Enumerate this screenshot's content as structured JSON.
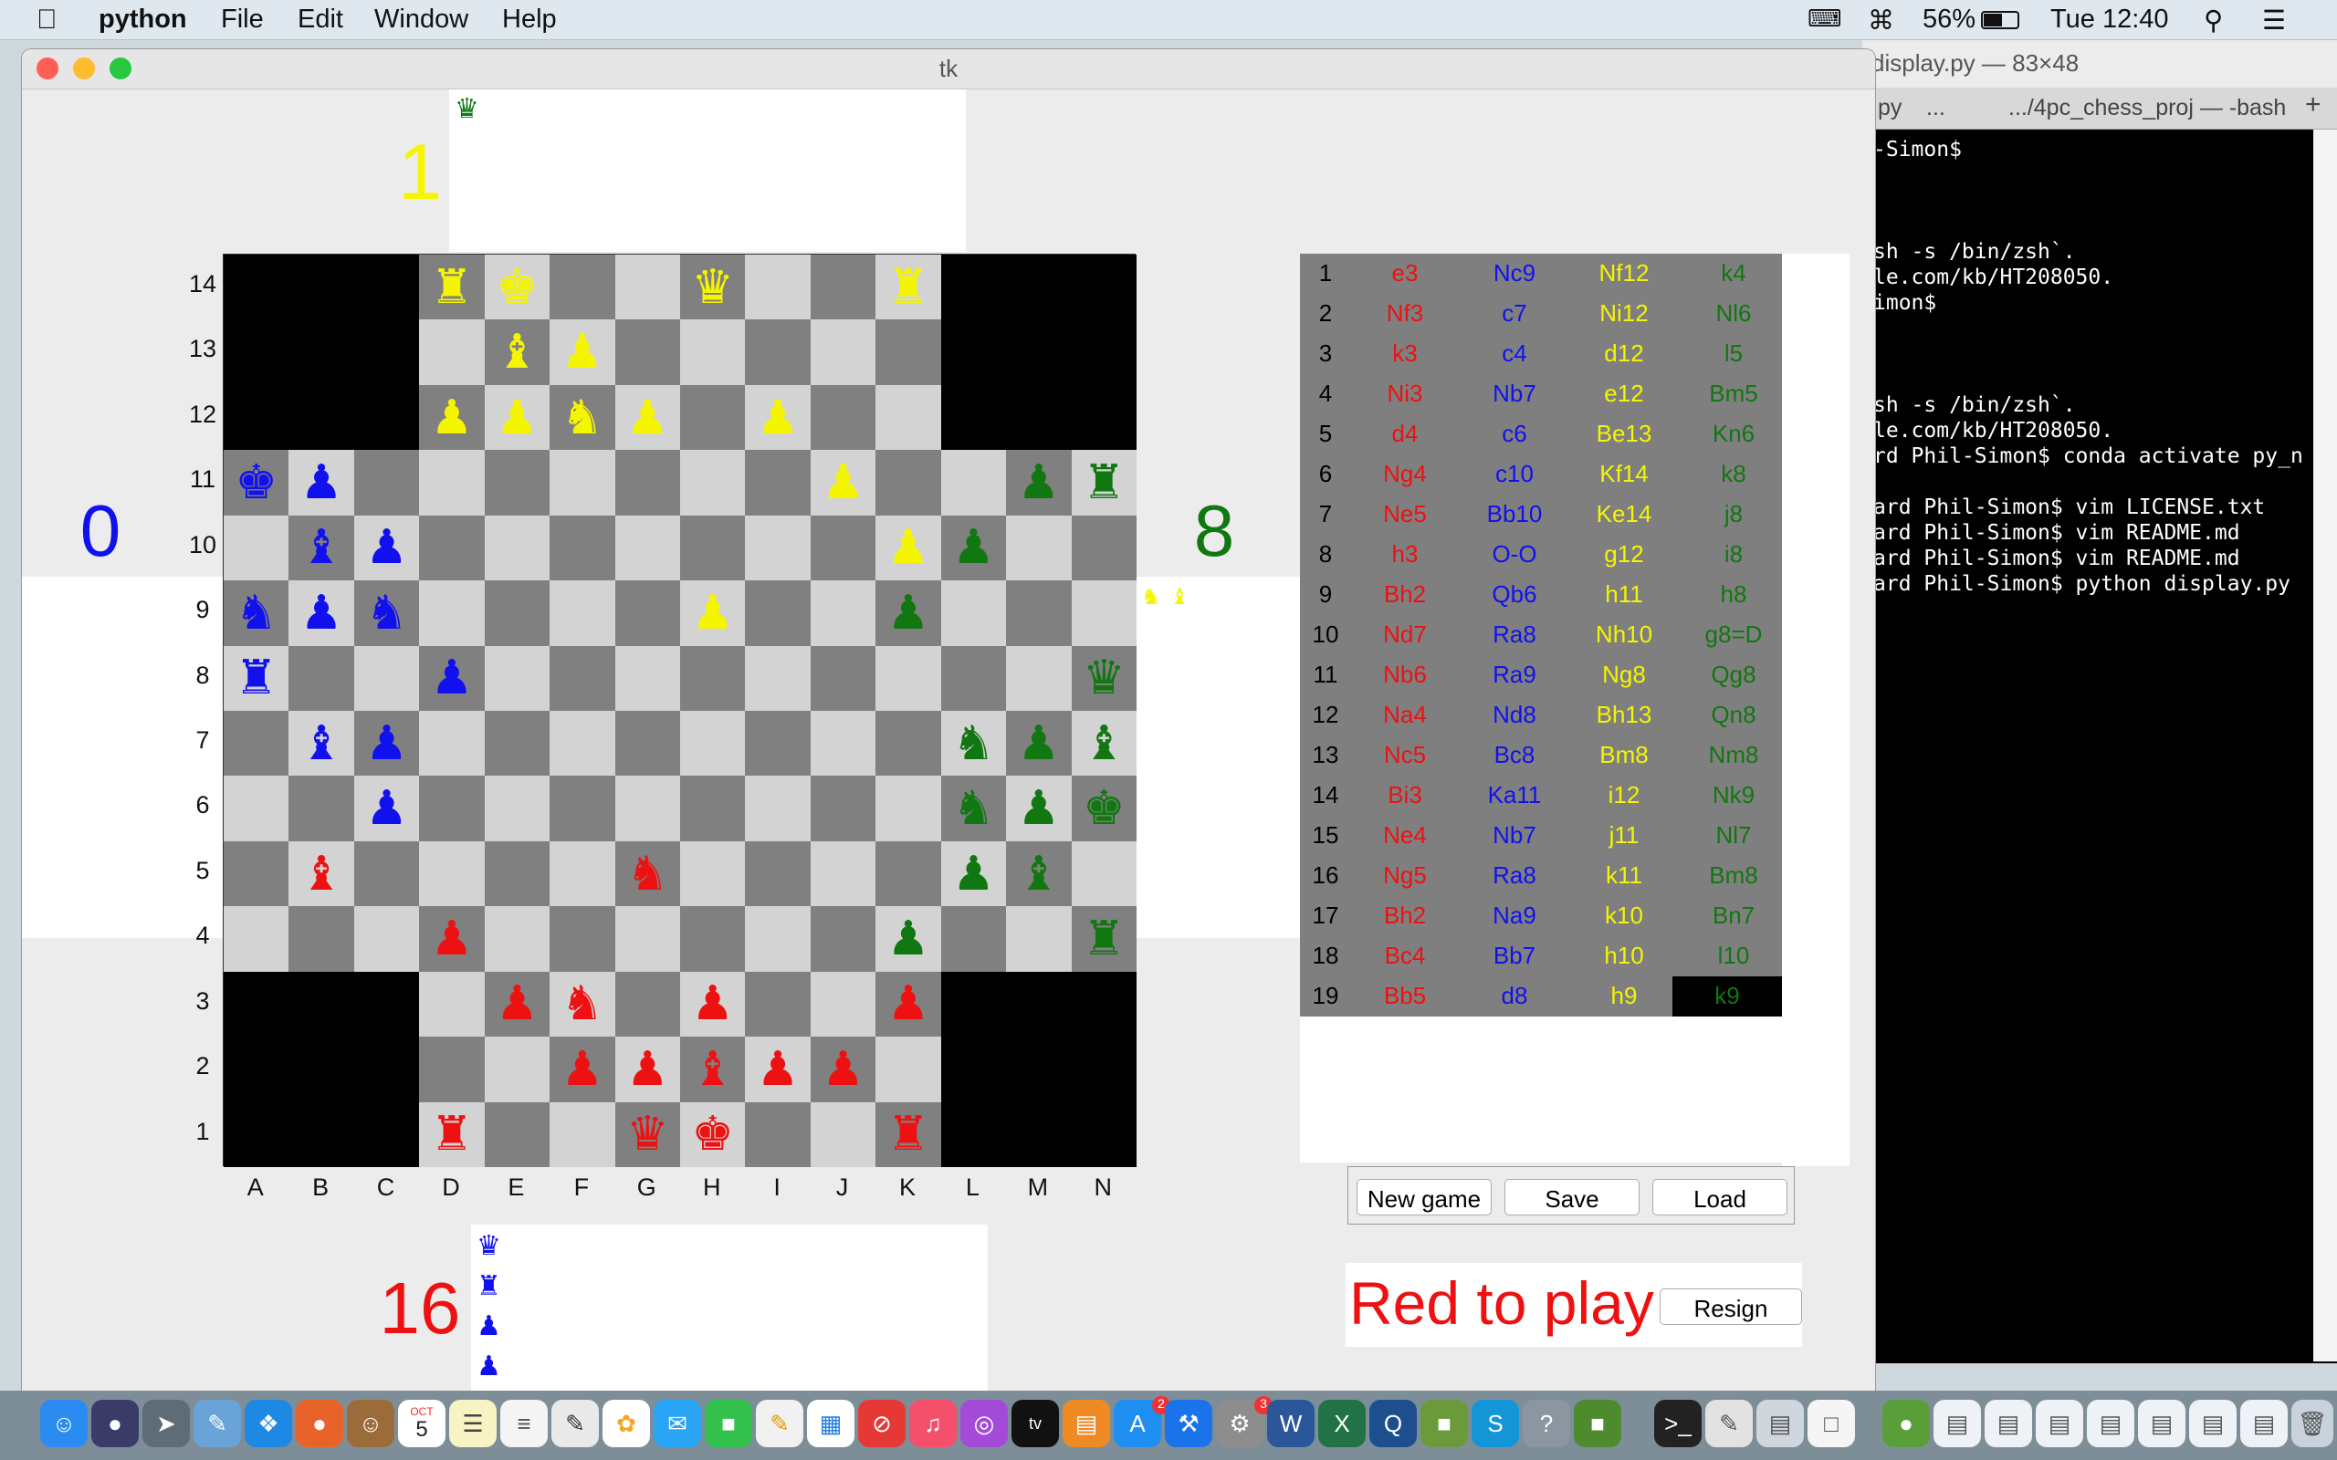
{
  "menubar": {
    "app": "python",
    "items": [
      "File",
      "Edit",
      "Window",
      "Help"
    ],
    "battery": "56%",
    "clock": "Tue 12:40"
  },
  "terminal": {
    "title": "display.py — 83×48",
    "tab1": ".py",
    "tab_more": "...",
    "tab2": ".../4pc_chess_proj — -bash",
    "lines": [
      "-Simon$",
      "",
      "",
      "",
      "sh -s /bin/zsh`.",
      "le.com/kb/HT208050.",
      "imon$",
      "",
      "",
      "",
      "sh -s /bin/zsh`.",
      "le.com/kb/HT208050.",
      "rd Phil-Simon$ conda activate py_n",
      "",
      "ard Phil-Simon$ vim LICENSE.txt",
      "ard Phil-Simon$ vim README.md",
      "ard Phil-Simon$ vim README.md",
      "ard Phil-Simon$ python display.py"
    ]
  },
  "window": {
    "title": "tk"
  },
  "scores": {
    "yellow": "1",
    "blue": "0",
    "green": "8",
    "red": "16"
  },
  "colors": {
    "red": "#ee1111",
    "blue": "#1111ee",
    "yellow": "#f5f500",
    "green": "#117711"
  },
  "captured": {
    "top": [
      "♛"
    ],
    "green_side": [
      "♞",
      "♝"
    ],
    "bottom": [
      "♛",
      "♜",
      "♟",
      "♟"
    ]
  },
  "board": {
    "rank_labels": [
      "14",
      "13",
      "12",
      "11",
      "10",
      "9",
      "8",
      "7",
      "6",
      "5",
      "4",
      "3",
      "2",
      "1"
    ],
    "file_labels": [
      "A",
      "B",
      "C",
      "D",
      "E",
      "F",
      "G",
      "H",
      "I",
      "J",
      "K",
      "L",
      "M",
      "N"
    ],
    "pieces": [
      {
        "sq": "D14",
        "g": "♜",
        "c": "y"
      },
      {
        "sq": "E14",
        "g": "♚",
        "c": "y"
      },
      {
        "sq": "H14",
        "g": "♛",
        "c": "y"
      },
      {
        "sq": "K14",
        "g": "♜",
        "c": "y"
      },
      {
        "sq": "E13",
        "g": "♝",
        "c": "y"
      },
      {
        "sq": "F13",
        "g": "♟",
        "c": "y"
      },
      {
        "sq": "D12",
        "g": "♟",
        "c": "y"
      },
      {
        "sq": "E12",
        "g": "♟",
        "c": "y"
      },
      {
        "sq": "F12",
        "g": "♞",
        "c": "y"
      },
      {
        "sq": "G12",
        "g": "♟",
        "c": "y"
      },
      {
        "sq": "I12",
        "g": "♟",
        "c": "y"
      },
      {
        "sq": "J11",
        "g": "♟",
        "c": "y"
      },
      {
        "sq": "K10",
        "g": "♟",
        "c": "y"
      },
      {
        "sq": "H9",
        "g": "♟",
        "c": "y"
      },
      {
        "sq": "A11",
        "g": "♚",
        "c": "b"
      },
      {
        "sq": "B11",
        "g": "♟",
        "c": "b"
      },
      {
        "sq": "B10",
        "g": "♝",
        "c": "b"
      },
      {
        "sq": "C10",
        "g": "♟",
        "c": "b"
      },
      {
        "sq": "A9",
        "g": "♞",
        "c": "b"
      },
      {
        "sq": "B9",
        "g": "♟",
        "c": "b"
      },
      {
        "sq": "C9",
        "g": "♞",
        "c": "b"
      },
      {
        "sq": "A8",
        "g": "♜",
        "c": "b"
      },
      {
        "sq": "D8",
        "g": "♟",
        "c": "b"
      },
      {
        "sq": "B7",
        "g": "♝",
        "c": "b"
      },
      {
        "sq": "C7",
        "g": "♟",
        "c": "b"
      },
      {
        "sq": "C6",
        "g": "♟",
        "c": "b"
      },
      {
        "sq": "M11",
        "g": "♟",
        "c": "g"
      },
      {
        "sq": "N11",
        "g": "♜",
        "c": "g"
      },
      {
        "sq": "L10",
        "g": "♟",
        "c": "g"
      },
      {
        "sq": "K9",
        "g": "♟",
        "c": "g"
      },
      {
        "sq": "N8",
        "g": "♛",
        "c": "g"
      },
      {
        "sq": "L7",
        "g": "♞",
        "c": "g"
      },
      {
        "sq": "M7",
        "g": "♟",
        "c": "g"
      },
      {
        "sq": "N7",
        "g": "♝",
        "c": "g"
      },
      {
        "sq": "L6",
        "g": "♞",
        "c": "g"
      },
      {
        "sq": "M6",
        "g": "♟",
        "c": "g"
      },
      {
        "sq": "N6",
        "g": "♚",
        "c": "g"
      },
      {
        "sq": "L5",
        "g": "♟",
        "c": "g"
      },
      {
        "sq": "M5",
        "g": "♝",
        "c": "g"
      },
      {
        "sq": "K4",
        "g": "♟",
        "c": "g"
      },
      {
        "sq": "N4",
        "g": "♜",
        "c": "g"
      },
      {
        "sq": "B5",
        "g": "♝",
        "c": "r"
      },
      {
        "sq": "G5",
        "g": "♞",
        "c": "r"
      },
      {
        "sq": "D4",
        "g": "♟",
        "c": "r"
      },
      {
        "sq": "E3",
        "g": "♟",
        "c": "r"
      },
      {
        "sq": "F3",
        "g": "♞",
        "c": "r"
      },
      {
        "sq": "H3",
        "g": "♟",
        "c": "r"
      },
      {
        "sq": "K3",
        "g": "♟",
        "c": "r"
      },
      {
        "sq": "F2",
        "g": "♟",
        "c": "r"
      },
      {
        "sq": "G2",
        "g": "♟",
        "c": "r"
      },
      {
        "sq": "H2",
        "g": "♝",
        "c": "r"
      },
      {
        "sq": "I2",
        "g": "♟",
        "c": "r"
      },
      {
        "sq": "J2",
        "g": "♟",
        "c": "r"
      },
      {
        "sq": "D1",
        "g": "♜",
        "c": "r"
      },
      {
        "sq": "G1",
        "g": "♛",
        "c": "r"
      },
      {
        "sq": "H1",
        "g": "♚",
        "c": "r"
      },
      {
        "sq": "K1",
        "g": "♜",
        "c": "r"
      }
    ]
  },
  "moves": [
    [
      "1",
      "e3",
      "Nc9",
      "Nf12",
      "k4"
    ],
    [
      "2",
      "Nf3",
      "c7",
      "Ni12",
      "Nl6"
    ],
    [
      "3",
      "k3",
      "c4",
      "d12",
      "l5"
    ],
    [
      "4",
      "Ni3",
      "Nb7",
      "e12",
      "Bm5"
    ],
    [
      "5",
      "d4",
      "c6",
      "Be13",
      "Kn6"
    ],
    [
      "6",
      "Ng4",
      "c10",
      "Kf14",
      "k8"
    ],
    [
      "7",
      "Ne5",
      "Bb10",
      "Ke14",
      "j8"
    ],
    [
      "8",
      "h3",
      "O-O",
      "g12",
      "i8"
    ],
    [
      "9",
      "Bh2",
      "Qb6",
      "h11",
      "h8"
    ],
    [
      "10",
      "Nd7",
      "Ra8",
      "Nh10",
      "g8=D"
    ],
    [
      "11",
      "Nb6",
      "Ra9",
      "Ng8",
      "Qg8"
    ],
    [
      "12",
      "Na4",
      "Nd8",
      "Bh13",
      "Qn8"
    ],
    [
      "13",
      "Nc5",
      "Bc8",
      "Bm8",
      "Nm8"
    ],
    [
      "14",
      "Bi3",
      "Ka11",
      "i12",
      "Nk9"
    ],
    [
      "15",
      "Ne4",
      "Nb7",
      "j11",
      "Nl7"
    ],
    [
      "16",
      "Ng5",
      "Ra8",
      "k11",
      "Bm8"
    ],
    [
      "17",
      "Bh2",
      "Na9",
      "k10",
      "Bn7"
    ],
    [
      "18",
      "Bc4",
      "Bb7",
      "h10",
      "l10"
    ],
    [
      "19",
      "Bb5",
      "d8",
      "h9",
      "k9"
    ]
  ],
  "buttons": {
    "new_game": "New game",
    "save": "Save",
    "load": "Load",
    "resign": "Resign"
  },
  "status": "Red to play",
  "dock": {
    "calendar_day": "5",
    "calendar_month": "OCT",
    "appstore_badge": "2",
    "prefs_badge": "3"
  }
}
